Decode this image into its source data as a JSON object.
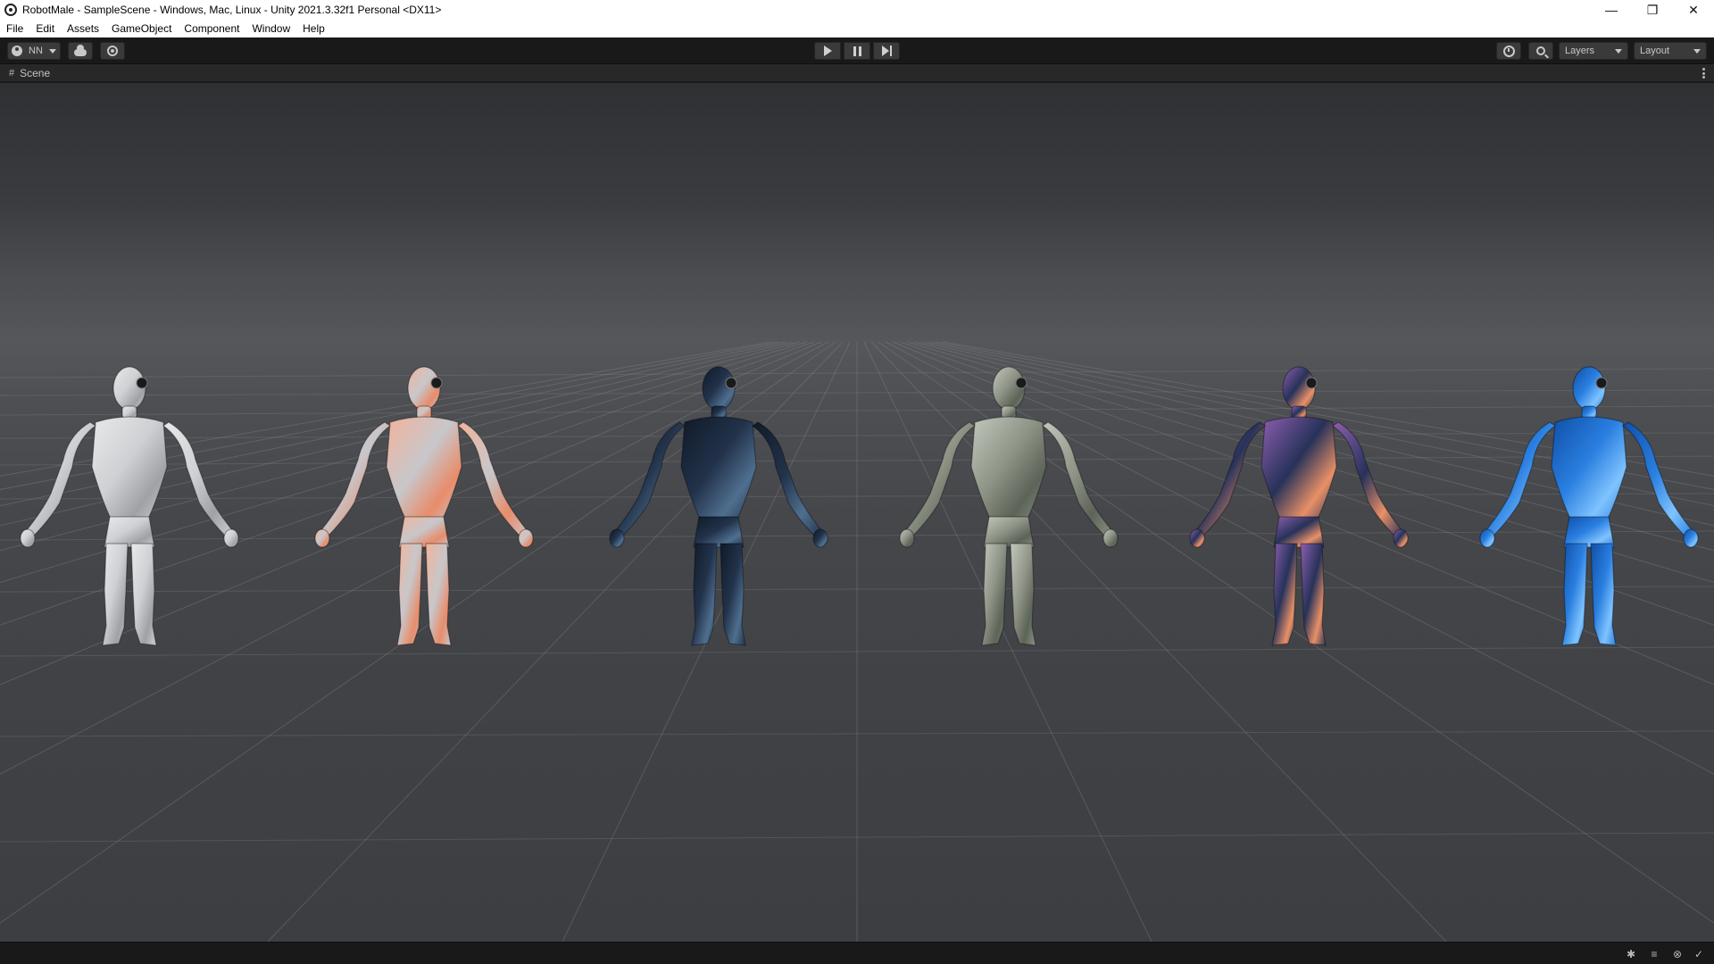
{
  "window": {
    "title": "RobotMale - SampleScene - Windows, Mac, Linux - Unity 2021.3.32f1 Personal <DX11>",
    "minimize_glyph": "—",
    "maximize_glyph": "❐",
    "close_glyph": "✕"
  },
  "menu": {
    "items": [
      "File",
      "Edit",
      "Assets",
      "GameObject",
      "Component",
      "Window",
      "Help"
    ]
  },
  "toolbar": {
    "account_label": "NN",
    "layers_label": "Layers",
    "layout_label": "Layout"
  },
  "scene_tab": {
    "hash_glyph": "#",
    "label": "Scene"
  },
  "figures": [
    {
      "name": "silver",
      "colors": [
        "#cfd0d3",
        "#9fa1a6",
        "#e8e9eb"
      ]
    },
    {
      "name": "floral",
      "colors": [
        "#c7c7cb",
        "#e88c6a",
        "#f3b39a"
      ]
    },
    {
      "name": "dark-marble",
      "colors": [
        "#22324a",
        "#4f6f8f",
        "#0f1a28"
      ]
    },
    {
      "name": "camo",
      "colors": [
        "#8d9385",
        "#5c6357",
        "#c3c8bd"
      ]
    },
    {
      "name": "nebula",
      "colors": [
        "#27325a",
        "#e99066",
        "#8e5fb0"
      ]
    },
    {
      "name": "water",
      "colors": [
        "#2a7fe0",
        "#7fc3ff",
        "#0f4fa8"
      ]
    }
  ],
  "statusbar": {
    "icons": [
      "debug-icon",
      "layers-stack-icon",
      "network-icon",
      "status-ok-icon"
    ]
  }
}
